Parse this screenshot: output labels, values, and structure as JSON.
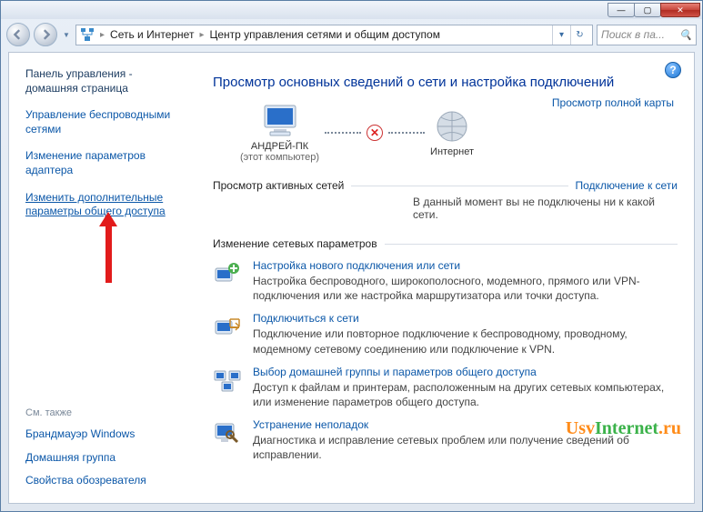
{
  "window": {
    "min": "—",
    "max": "▢",
    "close": "✕"
  },
  "address": {
    "crumb1": "Сеть и Интернет",
    "crumb2": "Центр управления сетями и общим доступом"
  },
  "search": {
    "placeholder": "Поиск в па..."
  },
  "sidebar": {
    "home": "Панель управления - домашняя страница",
    "items": [
      "Управление беспроводными сетями",
      "Изменение параметров адаптера",
      "Изменить дополнительные параметры общего доступа"
    ],
    "see_also_label": "См. также",
    "see_also": [
      "Брандмауэр Windows",
      "Домашняя группа",
      "Свойства обозревателя"
    ]
  },
  "main": {
    "title": "Просмотр основных сведений о сети и настройка подключений",
    "map_link": "Просмотр полной карты",
    "pc_name": "АНДРЕЙ-ПК",
    "pc_sub": "(этот компьютер)",
    "internet": "Интернет",
    "active_label": "Просмотр активных сетей",
    "active_link": "Подключение к сети",
    "active_msg": "В данный момент вы не подключены ни к какой сети.",
    "change_label": "Изменение сетевых параметров",
    "tasks": [
      {
        "title": "Настройка нового подключения или сети",
        "desc": "Настройка беспроводного, широкополосного, модемного, прямого или VPN-подключения или же настройка маршрутизатора или точки доступа."
      },
      {
        "title": "Подключиться к сети",
        "desc": "Подключение или повторное подключение к беспроводному, проводному, модемному сетевому соединению или подключение к VPN."
      },
      {
        "title": "Выбор домашней группы и параметров общего доступа",
        "desc": "Доступ к файлам и принтерам, расположенным на других сетевых компьютерах, или изменение параметров общего доступа."
      },
      {
        "title": "Устранение неполадок",
        "desc": "Диагностика и исправление сетевых проблем или получение сведений об исправлении."
      }
    ]
  },
  "watermark": {
    "a": "Usv",
    "b": "Internet",
    "c": ".ru"
  }
}
